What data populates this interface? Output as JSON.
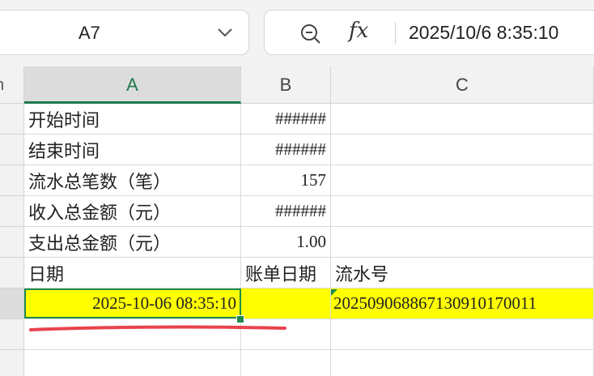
{
  "namebox": {
    "value": "A7"
  },
  "formula_bar": {
    "value": "2025/10/6 8:35:10",
    "fx_label": "fx"
  },
  "corner_fragment": "n",
  "columns": [
    {
      "label": "A",
      "active": true
    },
    {
      "label": "B",
      "active": false
    },
    {
      "label": "C",
      "active": false
    }
  ],
  "rows": [
    {
      "a": "开始时间",
      "b": "######",
      "c": ""
    },
    {
      "a": "结束时间",
      "b": "######",
      "c": ""
    },
    {
      "a": "流水总笔数（笔）",
      "b": "157",
      "c": ""
    },
    {
      "a": "收入总金额（元）",
      "b": "######",
      "c": ""
    },
    {
      "a": "支出总金额（元）",
      "b": "1.00",
      "c": ""
    },
    {
      "a": "日期",
      "b": "账单日期",
      "c": "流水号"
    },
    {
      "a": "2025-10-06 08:35:10",
      "b": "",
      "c": "202509068867130910170011"
    },
    {
      "a": "",
      "b": "",
      "c": ""
    },
    {
      "a": "",
      "b": "",
      "c": ""
    }
  ],
  "colors": {
    "accent_green": "#1e8a4c",
    "highlight_yellow": "#ffff00",
    "annotation_red": "#e8434d"
  }
}
